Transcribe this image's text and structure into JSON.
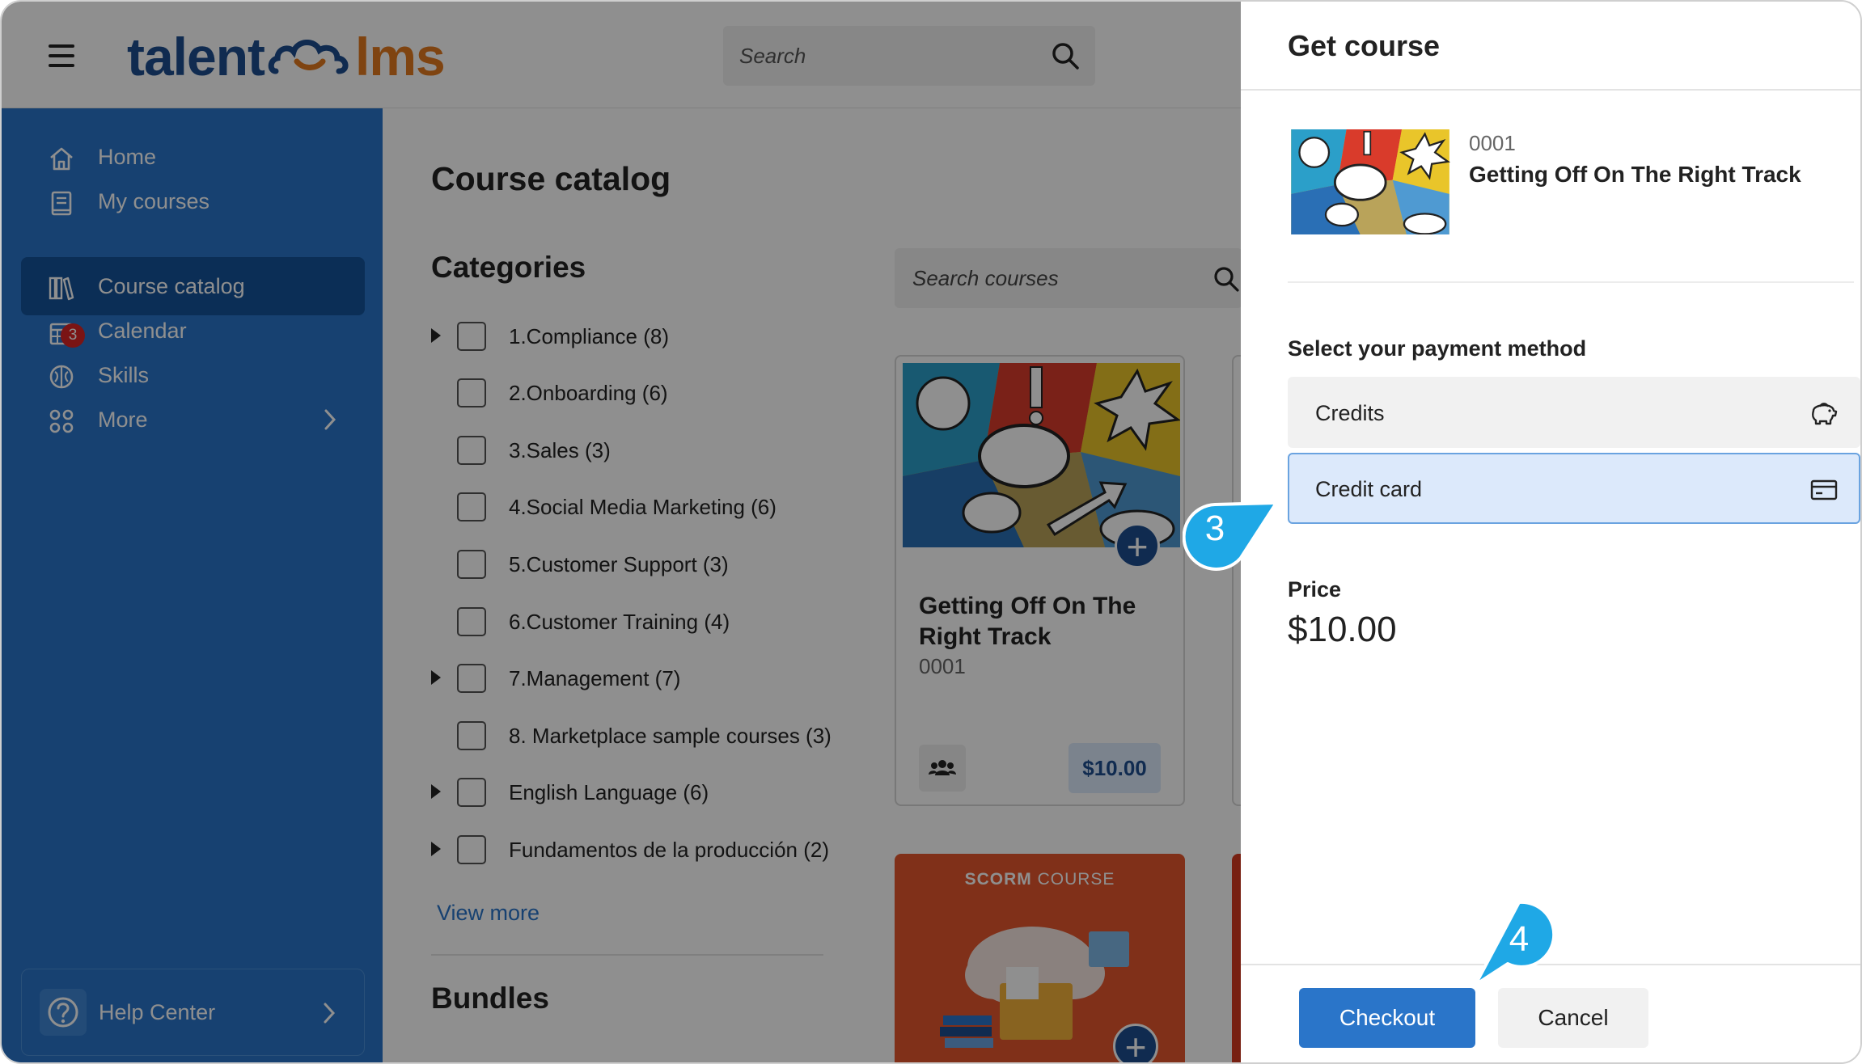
{
  "app": {
    "logo_left": "talent",
    "logo_right": "lms",
    "search_placeholder": "Search"
  },
  "sidebar": {
    "items": [
      {
        "label": "Home"
      },
      {
        "label": "My courses"
      },
      {
        "label": "Course catalog"
      },
      {
        "label": "Calendar"
      },
      {
        "label": "Skills"
      },
      {
        "label": "More"
      }
    ],
    "calendar_badge": "3",
    "help_center": "Help Center"
  },
  "main": {
    "title": "Course catalog",
    "categories_title": "Categories",
    "categories": [
      {
        "label": "1.Compliance (8)",
        "expandable": true
      },
      {
        "label": "2.Onboarding (6)",
        "expandable": false
      },
      {
        "label": "3.Sales (3)",
        "expandable": false
      },
      {
        "label": "4.Social Media Marketing (6)",
        "expandable": false
      },
      {
        "label": "5.Customer Support (3)",
        "expandable": false
      },
      {
        "label": "6.Customer Training (4)",
        "expandable": false
      },
      {
        "label": "7.Management (7)",
        "expandable": true
      },
      {
        "label": "8. Marketplace sample courses (3)",
        "expandable": false
      },
      {
        "label": "English Language (6)",
        "expandable": true
      },
      {
        "label": "Fundamentos de la producción (2)",
        "expandable": true
      }
    ],
    "view_more": "View more",
    "bundles_title": "Bundles",
    "course_search_placeholder": "Search courses",
    "course_card": {
      "title": "Getting Off On The Right Track",
      "code": "0001",
      "price": "$10.00"
    },
    "scorm_card": {
      "label_bold": "SCORM",
      "label_rest": " COURSE"
    }
  },
  "panel": {
    "title": "Get course",
    "course_code": "0001",
    "course_name": "Getting Off On The Right Track",
    "payment_label": "Select your payment method",
    "options": [
      {
        "label": "Credits",
        "icon": "piggy-bank-icon",
        "selected": false
      },
      {
        "label": "Credit card",
        "icon": "credit-card-icon",
        "selected": true
      }
    ],
    "price_label": "Price",
    "price_value": "$10.00",
    "checkout_label": "Checkout",
    "cancel_label": "Cancel"
  },
  "callouts": {
    "step_3": "3",
    "step_4": "4"
  },
  "colors": {
    "brand_blue": "#2a75c9",
    "brand_dark_blue": "#1d4d8f",
    "brand_orange": "#e27a1f",
    "callout": "#1fa8e6",
    "selected_bg": "#dce9fb"
  }
}
